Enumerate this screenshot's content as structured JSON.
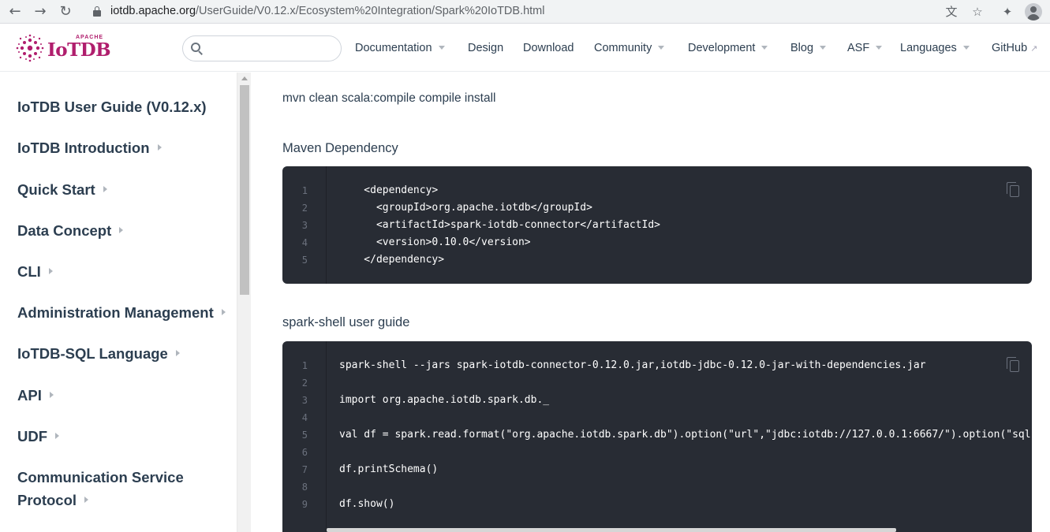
{
  "browser": {
    "url_host": "iotdb.apache.org",
    "url_path": "/UserGuide/V0.12.x/Ecosystem%20Integration/Spark%20IoTDB.html"
  },
  "header": {
    "logo_small": "APACHE",
    "logo_text": "IoTDB",
    "search": {
      "value": "",
      "placeholder": ""
    },
    "nav": [
      {
        "label": "Documentation",
        "dropdown": true
      },
      {
        "label": "Design",
        "dropdown": false
      },
      {
        "label": "Download",
        "dropdown": false
      },
      {
        "label": "Community",
        "dropdown": true
      },
      {
        "label": "Development",
        "dropdown": true
      },
      {
        "label": "Blog",
        "dropdown": true
      },
      {
        "label": "ASF",
        "dropdown": true
      },
      {
        "label": "Languages",
        "dropdown": true
      },
      {
        "label": "GitHub",
        "external": true
      }
    ]
  },
  "sidebar": {
    "items": [
      {
        "label": "IoTDB User Guide (V0.12.x)"
      },
      {
        "label": "IoTDB Introduction"
      },
      {
        "label": "Quick Start"
      },
      {
        "label": "Data Concept"
      },
      {
        "label": "CLI"
      },
      {
        "label": "Administration Management"
      },
      {
        "label": "IoTDB-SQL Language"
      },
      {
        "label": "API"
      },
      {
        "label": "UDF"
      },
      {
        "label": "Communication Service",
        "label2": "Protocol"
      }
    ]
  },
  "content": {
    "command": "mvn clean scala:compile compile install",
    "maven_title": "Maven Dependency",
    "maven_code": {
      "line_numbers": [
        "1",
        "2",
        "3",
        "4",
        "5"
      ],
      "lines": [
        "    <dependency>",
        "      <groupId>org.apache.iotdb</groupId>",
        "      <artifactId>spark-iotdb-connector</artifactId>",
        "      <version>0.10.0</version>",
        "    </dependency>"
      ]
    },
    "spark_title": "spark-shell user guide",
    "spark_code": {
      "line_numbers": [
        "1",
        "2",
        "3",
        "4",
        "5",
        "6",
        "7",
        "8",
        "9"
      ],
      "lines": [
        "spark-shell --jars spark-iotdb-connector-0.12.0.jar,iotdb-jdbc-0.12.0-jar-with-dependencies.jar",
        "",
        "import org.apache.iotdb.spark.db._",
        "",
        "val df = spark.read.format(\"org.apache.iotdb.spark.db\").option(\"url\",\"jdbc:iotdb://127.0.0.1:6667/\").option(\"sql\",\"select * from root\").load",
        "",
        "df.printSchema()",
        "",
        "df.show()"
      ]
    }
  }
}
